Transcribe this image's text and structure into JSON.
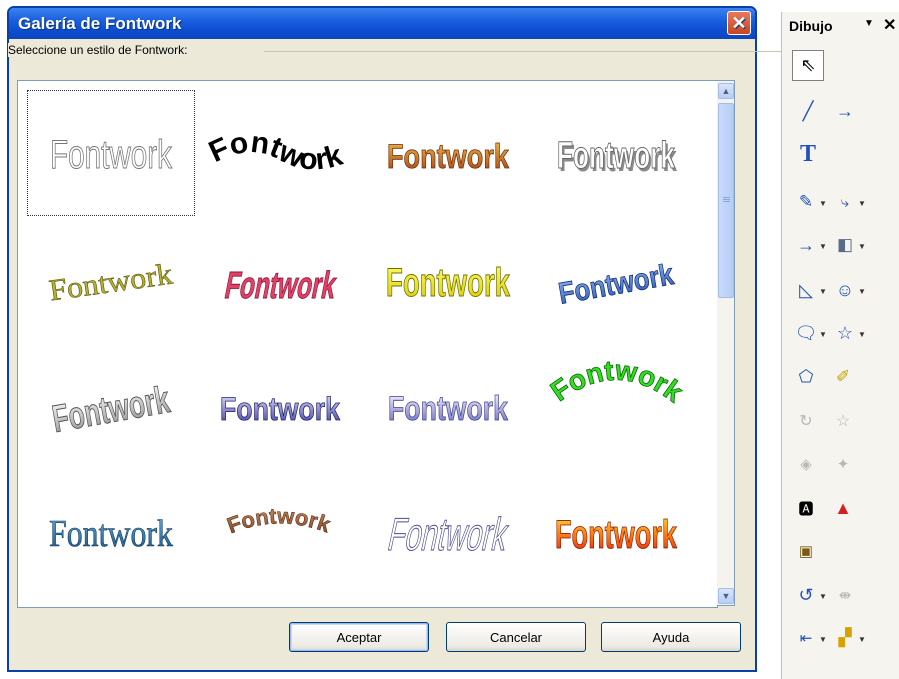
{
  "dialog": {
    "title": "Galería de Fontwork",
    "prompt": "Seleccione un estilo de Fontwork:",
    "buttons": {
      "ok": "Aceptar",
      "cancel": "Cancelar",
      "help": "Ayuda"
    },
    "styles": [
      {
        "text": "Fontwork"
      },
      {
        "text": "Fontwork"
      },
      {
        "text": "Fontwork"
      },
      {
        "text": "Fontwork"
      },
      {
        "text": "Fontwork"
      },
      {
        "text": "Fontwork"
      },
      {
        "text": "Fontwork"
      },
      {
        "text": "Fontwork"
      },
      {
        "text": "Fontwork"
      },
      {
        "text": "Fontwork"
      },
      {
        "text": "Fontwork"
      },
      {
        "text": "Fontwork"
      },
      {
        "text": "Fontwork"
      },
      {
        "text": "Fontwork"
      },
      {
        "text": "Fontwork"
      },
      {
        "text": "Fontwork"
      }
    ]
  },
  "toolbar": {
    "title": "Dibujo",
    "tools": [
      "select-icon",
      "line-icon",
      "arrow-line-icon",
      "text-icon",
      "curve-icon",
      "connector-icon",
      "line-arrow-icon",
      "3d-object-icon",
      "basic-shapes-icon",
      "symbol-shapes-icon",
      "callouts-icon",
      "stars-icon",
      "points-icon",
      "glue-points-icon",
      "rotate-icon",
      "mirror-icon",
      "extrusion-icon",
      "lighting-icon",
      "fontwork-icon",
      "image-icon",
      "from-file-icon",
      "rotate-arrow-icon",
      "align-icon",
      "arrange-icon",
      "group-icon"
    ]
  }
}
